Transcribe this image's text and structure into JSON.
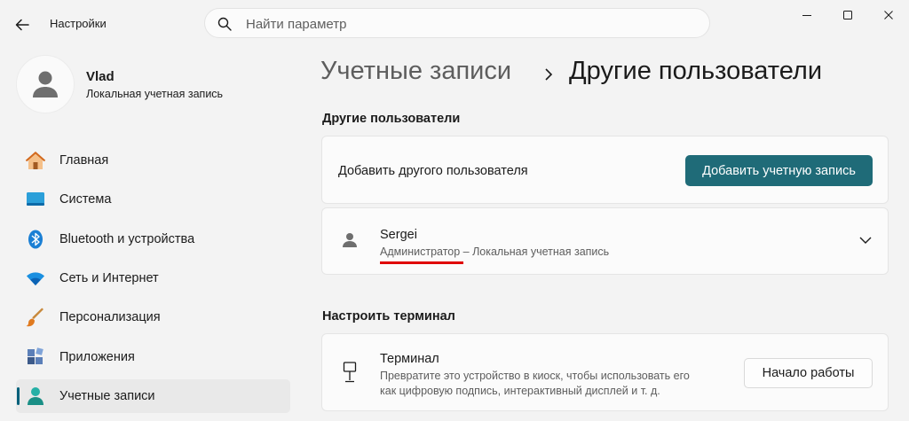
{
  "app": {
    "title": "Настройки"
  },
  "search": {
    "placeholder": "Найти параметр"
  },
  "profile": {
    "name": "Vlad",
    "subtitle": "Локальная учетная запись"
  },
  "nav": {
    "items": [
      {
        "label": "Главная",
        "icon": "home-icon"
      },
      {
        "label": "Система",
        "icon": "system-icon"
      },
      {
        "label": "Bluetooth и устройства",
        "icon": "bluetooth-icon"
      },
      {
        "label": "Сеть и Интернет",
        "icon": "wifi-icon"
      },
      {
        "label": "Персонализация",
        "icon": "brush-icon"
      },
      {
        "label": "Приложения",
        "icon": "apps-icon"
      },
      {
        "label": "Учетные записи",
        "icon": "accounts-icon",
        "active": true
      }
    ]
  },
  "breadcrumb": {
    "parent": "Учетные записи",
    "current": "Другие пользователи"
  },
  "other_users": {
    "section_title": "Другие пользователи",
    "add_label": "Добавить другого пользователя",
    "add_button": "Добавить учетную запись",
    "user": {
      "name": "Sergei",
      "role": "Администратор",
      "detail": " – Локальная учетная запись"
    }
  },
  "kiosk": {
    "section_title": "Настроить терминал",
    "title": "Терминал",
    "description_line1": "Превратите это устройство в киоск, чтобы использовать его",
    "description_line2": "как цифровую подпись, интерактивный дисплей и т. д.",
    "button": "Начало работы"
  },
  "colors": {
    "accent": "#1f6b78",
    "annotation": "#e00000",
    "nav_indicator": "#00607a"
  }
}
